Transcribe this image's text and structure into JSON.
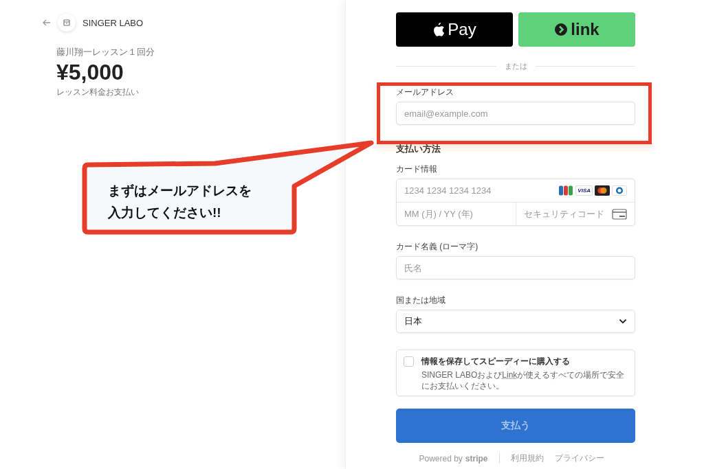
{
  "merchant": {
    "name": "SINGER LABO"
  },
  "product": {
    "title": "藤川翔一レッスン１回分",
    "price": "¥5,000",
    "description": "レッスン料金お支払い"
  },
  "wallet_buttons": [
    {
      "kind": "apple",
      "label": "Pay"
    },
    {
      "kind": "link",
      "label": "link"
    }
  ],
  "divider_text": "または",
  "email": {
    "label": "メールアドレス",
    "placeholder": "email@example.com"
  },
  "payment_method": {
    "heading": "支払い方法"
  },
  "card": {
    "label": "カード情報",
    "number_placeholder": "1234 1234 1234 1234",
    "visa_label": "VISA",
    "expiry_placeholder": "MM (月) / YY (年)",
    "cvc_placeholder": "セキュリティコード"
  },
  "cardholder": {
    "label": "カード名義 (ローマ字)",
    "placeholder": "氏名"
  },
  "country": {
    "label": "国または地域",
    "value": "日本"
  },
  "save_info": {
    "checked": false,
    "title": "情報を保存してスピーディーに購入する",
    "text_before": "SINGER LABOおよび",
    "link": "Link",
    "text_after": "が使えるすべての場所で安全にお支払いください。"
  },
  "pay_button": "支払う",
  "footer": {
    "powered_by": "Powered by",
    "brand": "stripe",
    "links": [
      "利用規約",
      "プライバシー"
    ]
  },
  "annotation": {
    "lines": [
      "まずはメールアドレスを",
      "入力してください!!"
    ]
  }
}
